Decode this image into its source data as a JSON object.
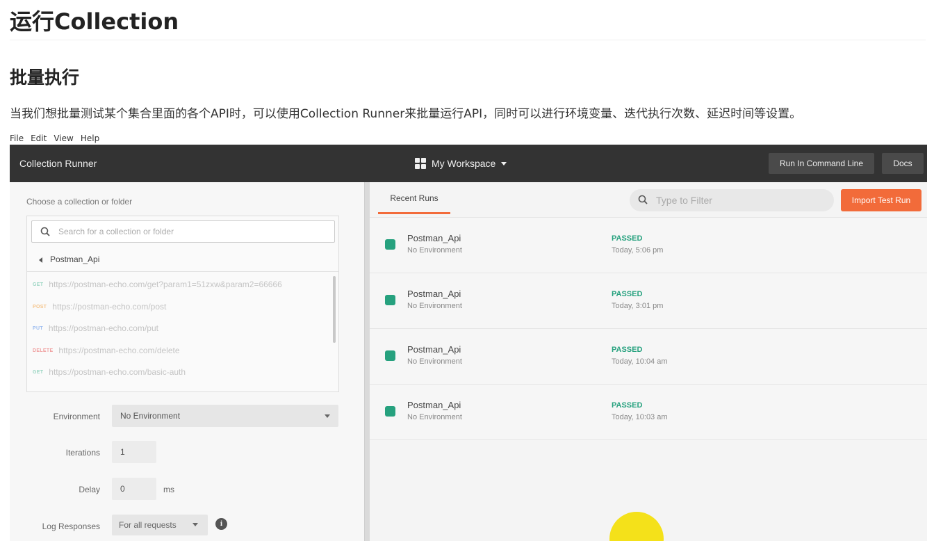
{
  "doc": {
    "title": "运行Collection",
    "subtitle": "批量执行",
    "paragraph": "当我们想批量测试某个集合里面的各个API时，可以使用Collection Runner来批量运行API，同时可以进行环境变量、迭代执行次数、延迟时间等设置。"
  },
  "menubar": [
    "File",
    "Edit",
    "View",
    "Help"
  ],
  "topbar": {
    "title": "Collection Runner",
    "workspace": "My Workspace",
    "run_cmd_label": "Run In Command Line",
    "docs_label": "Docs"
  },
  "left": {
    "choose_label": "Choose a collection or folder",
    "search_placeholder": "Search for a collection or folder",
    "collection_name": "Postman_Api",
    "requests": [
      {
        "method": "GET",
        "url": "https://postman-echo.com/get?param1=51zxw&param2=66666"
      },
      {
        "method": "POST",
        "url": "https://postman-echo.com/post"
      },
      {
        "method": "PUT",
        "url": "https://postman-echo.com/put"
      },
      {
        "method": "DELETE",
        "url": "https://postman-echo.com/delete"
      },
      {
        "method": "GET",
        "url": "https://postman-echo.com/basic-auth"
      }
    ],
    "environment_label": "Environment",
    "environment_value": "No Environment",
    "iterations_label": "Iterations",
    "iterations_value": "1",
    "delay_label": "Delay",
    "delay_value": "0",
    "delay_unit": "ms",
    "log_label": "Log Responses",
    "log_value": "For all requests"
  },
  "right": {
    "tab_label": "Recent Runs",
    "filter_placeholder": "Type to Filter",
    "import_label": "Import Test Run",
    "runs": [
      {
        "name": "Postman_Api",
        "env": "No Environment",
        "status": "PASSED",
        "time": "Today, 5:06 pm"
      },
      {
        "name": "Postman_Api",
        "env": "No Environment",
        "status": "PASSED",
        "time": "Today, 3:01 pm"
      },
      {
        "name": "Postman_Api",
        "env": "No Environment",
        "status": "PASSED",
        "time": "Today, 10:04 am"
      },
      {
        "name": "Postman_Api",
        "env": "No Environment",
        "status": "PASSED",
        "time": "Today, 10:03 am"
      }
    ]
  },
  "colors": {
    "accent": "#f26b3a",
    "passed": "#26a17e",
    "topbar": "#333333"
  }
}
